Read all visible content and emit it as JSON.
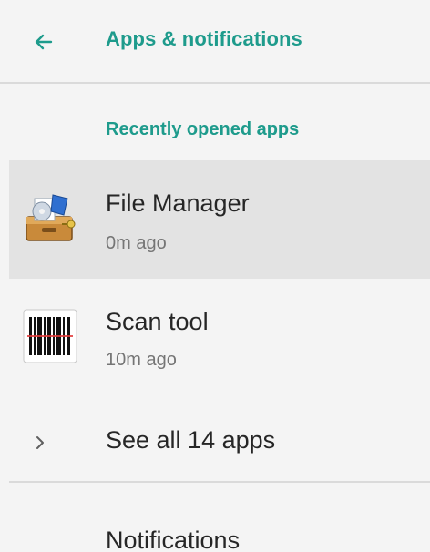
{
  "app_bar": {
    "title": "Apps & notifications",
    "back_icon": "arrow-left-icon"
  },
  "colors": {
    "accent": "#1e9b8c",
    "selected_row": "#e3e3e3",
    "background": "#f4f4f4",
    "divider": "#dadada"
  },
  "recent": {
    "header": "Recently opened apps",
    "apps": [
      {
        "name": "File Manager",
        "time": "0m ago",
        "icon": "file-manager-icon"
      },
      {
        "name": "Scan tool",
        "time": "10m ago",
        "icon": "barcode-scanner-icon"
      }
    ]
  },
  "see_all": {
    "label": "See all 14 apps",
    "icon": "chevron-right-icon"
  },
  "notifications": {
    "label": "Notifications"
  }
}
